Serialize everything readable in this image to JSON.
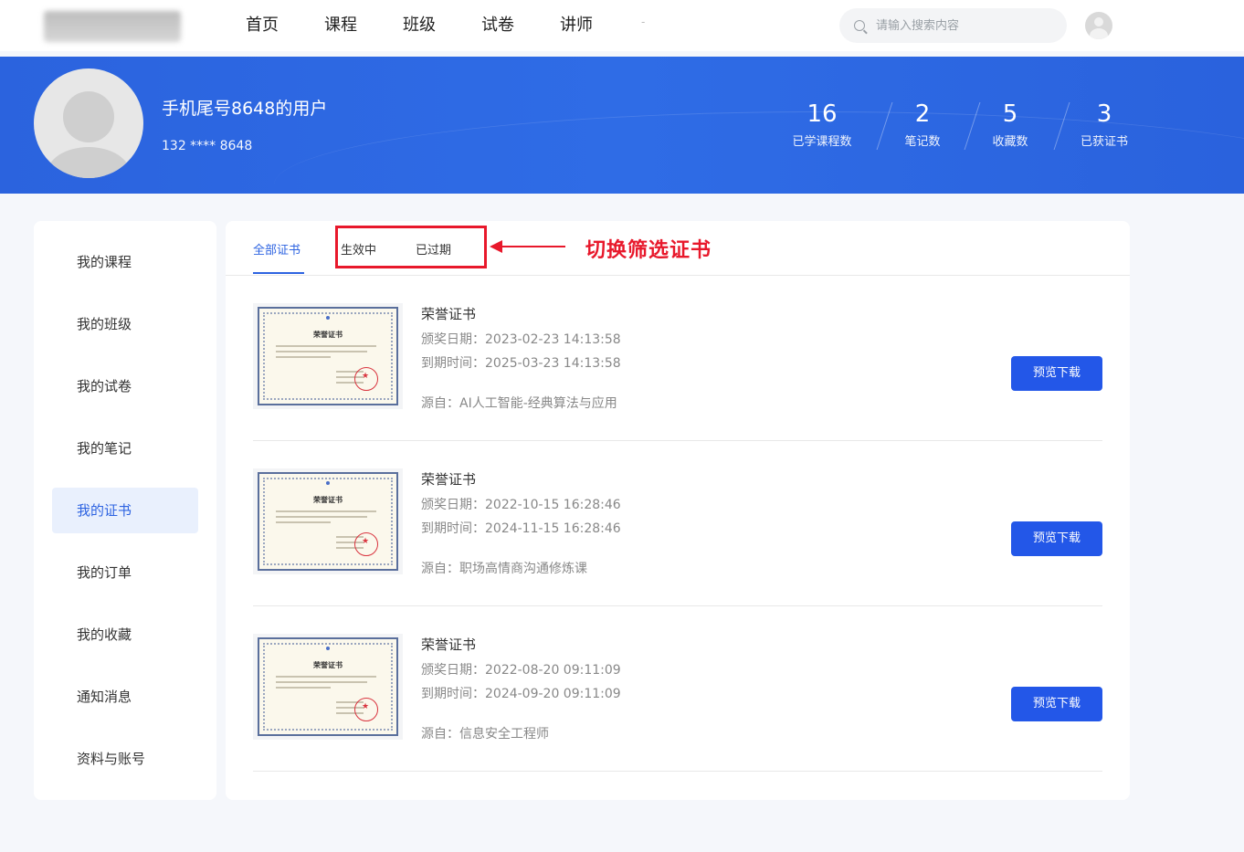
{
  "nav": {
    "items": [
      "首页",
      "课程",
      "班级",
      "试卷",
      "讲师"
    ],
    "extra": "-"
  },
  "search": {
    "placeholder": "请输入搜索内容"
  },
  "profile": {
    "name": "手机尾号8648的用户",
    "phone": "132 **** 8648",
    "stats": [
      {
        "value": "16",
        "label": "已学课程数"
      },
      {
        "value": "2",
        "label": "笔记数"
      },
      {
        "value": "5",
        "label": "收藏数"
      },
      {
        "value": "3",
        "label": "已获证书"
      }
    ]
  },
  "sidebar": {
    "items": [
      "我的课程",
      "我的班级",
      "我的试卷",
      "我的笔记",
      "我的证书",
      "我的订单",
      "我的收藏",
      "通知消息",
      "资料与账号"
    ],
    "active": "我的证书"
  },
  "tabs": {
    "all": "全部证书",
    "active": "生效中",
    "expired": "已过期"
  },
  "annotation": "切换筛选证书",
  "certificates": [
    {
      "thumb_title": "荣誉证书",
      "title": "荣誉证书",
      "award_date": "颁奖日期：2023-02-23 14:13:58",
      "expire_date": "到期时间：2025-03-23 14:13:58",
      "source": "源自：AI人工智能-经典算法与应用",
      "button": "预览下载"
    },
    {
      "thumb_title": "荣誉证书",
      "title": "荣誉证书",
      "award_date": "颁奖日期：2022-10-15 16:28:46",
      "expire_date": "到期时间：2024-11-15 16:28:46",
      "source": "源自：职场高情商沟通修炼课",
      "button": "预览下载"
    },
    {
      "thumb_title": "荣誉证书",
      "title": "荣誉证书",
      "award_date": "颁奖日期：2022-08-20 09:11:09",
      "expire_date": "到期时间：2024-09-20 09:11:09",
      "source": "源自：信息安全工程师",
      "button": "预览下载"
    }
  ],
  "colors": {
    "primary": "#2357e8",
    "banner": "#2b63de",
    "annotation": "#e8182b"
  }
}
